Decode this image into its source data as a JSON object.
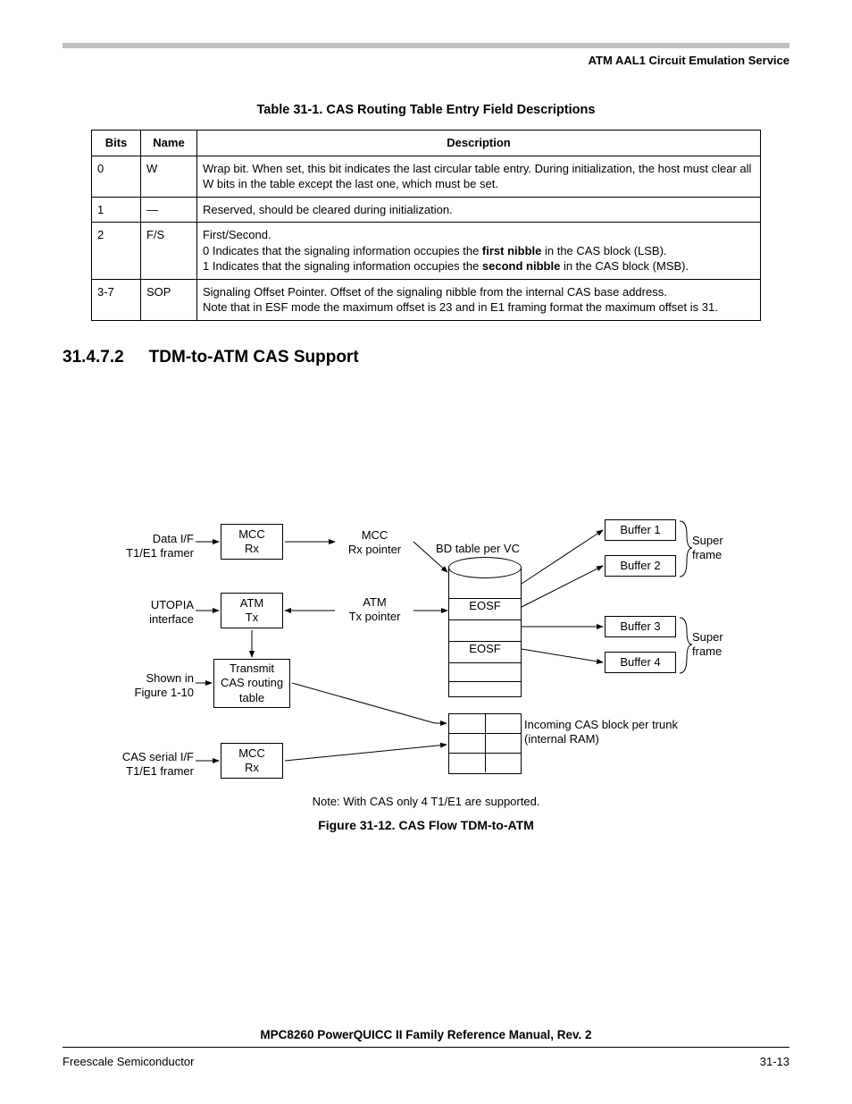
{
  "header": {
    "chapter_title": "ATM AAL1 Circuit Emulation Service"
  },
  "table": {
    "caption": "Table 31-1. CAS Routing Table Entry Field Descriptions",
    "headers": {
      "bits": "Bits",
      "name": "Name",
      "desc": "Description"
    },
    "rows": [
      {
        "bits": "0",
        "name": "W",
        "desc_html": "Wrap bit. When set, this bit indicates the last circular table entry. During initialization, the host must clear all W bits in the table except the last one, which must be set."
      },
      {
        "bits": "1",
        "name": "—",
        "desc_html": "Reserved, should be cleared during initialization."
      },
      {
        "bits": "2",
        "name": "F/S",
        "desc_html": "First/Second.<br>0 Indicates that the signaling information occupies the <b>first nibble</b> in the CAS block (LSB).<br>1 Indicates that the signaling information occupies the <b>second nibble</b> in the CAS block (MSB)."
      },
      {
        "bits": "3-7",
        "name": "SOP",
        "desc_html": "Signaling Offset Pointer. Offset of the signaling nibble from the internal CAS base address.<br>Note that in ESF mode the maximum offset is 23 and in E1 framing format the maximum offset is 31."
      }
    ]
  },
  "section": {
    "number": "31.4.7.2",
    "title": "TDM-to-ATM CAS Support"
  },
  "figure": {
    "labels": {
      "data_if": "Data I/F\nT1/E1 framer",
      "utopia": "UTOPIA\ninterface",
      "shown_in": "Shown in\nFigure 1-10",
      "cas_serial": "CAS serial I/F\nT1/E1 framer",
      "mcc_rx1": "MCC\nRx",
      "atm_tx": "ATM\nTx",
      "mcc_rx2": "MCC\nRx",
      "txcas": "Transmit\nCAS routing\ntable",
      "mcc_rx_ptr": "MCC\nRx pointer",
      "atm_tx_ptr": "ATM\nTx pointer",
      "bd_table": "BD table per VC",
      "eosf1": "EOSF",
      "eosf2": "EOSF",
      "buffer1": "Buffer 1",
      "buffer2": "Buffer 2",
      "buffer3": "Buffer 3",
      "buffer4": "Buffer 4",
      "sf1": "Super\nframe",
      "sf2": "Super\nframe",
      "incoming": "Incoming CAS block per trunk\n(internal RAM)"
    },
    "note": "Note:  With CAS only 4 T1/E1 are supported.",
    "caption": "Figure 31-12. CAS Flow TDM-to-ATM"
  },
  "footer": {
    "doc_title": "MPC8260 PowerQUICC II Family Reference Manual, Rev. 2",
    "company": "Freescale Semiconductor",
    "page_num": "31-13"
  },
  "chart_data": {
    "type": "table",
    "title": "CAS Routing Table Entry Field Descriptions",
    "columns": [
      "Bits",
      "Name",
      "Description"
    ],
    "rows": [
      [
        "0",
        "W",
        "Wrap bit. When set, this bit indicates the last circular table entry. During initialization, the host must clear all W bits in the table except the last one, which must be set."
      ],
      [
        "1",
        "—",
        "Reserved, should be cleared during initialization."
      ],
      [
        "2",
        "F/S",
        "First/Second. 0 Indicates that the signaling information occupies the first nibble in the CAS block (LSB). 1 Indicates that the signaling information occupies the second nibble in the CAS block (MSB)."
      ],
      [
        "3-7",
        "SOP",
        "Signaling Offset Pointer. Offset of the signaling nibble from the internal CAS base address. Note that in ESF mode the maximum offset is 23 and in E1 framing format the maximum offset is 31."
      ]
    ]
  }
}
